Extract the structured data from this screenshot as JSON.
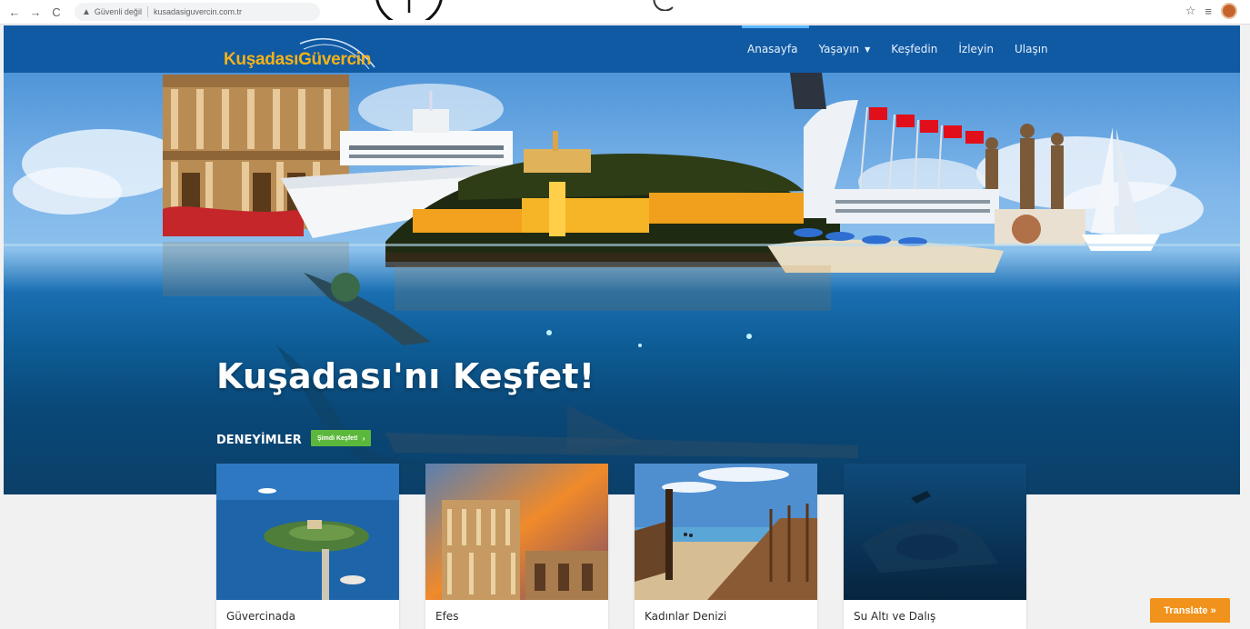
{
  "browser": {
    "security_label": "Güvenli değil",
    "url": "kusadasiguvercin.com.tr"
  },
  "site": {
    "logo": "KuşadasıGüvercin",
    "nav": [
      {
        "label": "Anasayfa",
        "active": true
      },
      {
        "label": "Yaşayın",
        "dropdown": true
      },
      {
        "label": "Keşfedin"
      },
      {
        "label": "İzleyin"
      },
      {
        "label": "Ulaşın"
      }
    ]
  },
  "hero": {
    "title": "Kuşadası'nı Keşfet!",
    "experiences_label": "DENEYİMLER",
    "discover_button": "Şimdi Keşfet!",
    "discover_arrow": "›"
  },
  "cards": [
    {
      "title": "Güvercinada",
      "icon": "island-photo"
    },
    {
      "title": "Efes",
      "icon": "ephesus-library-photo"
    },
    {
      "title": "Kadınlar Denizi",
      "icon": "beach-pier-photo"
    },
    {
      "title": "Su Altı ve Dalış",
      "icon": "underwater-wreck-photo"
    }
  ],
  "translate": {
    "label": "Translate »"
  },
  "colors": {
    "header_bg": "#105aa4",
    "logo": "#f6b217",
    "discover_button": "#5cb83c",
    "translate_button": "#f0921b"
  }
}
